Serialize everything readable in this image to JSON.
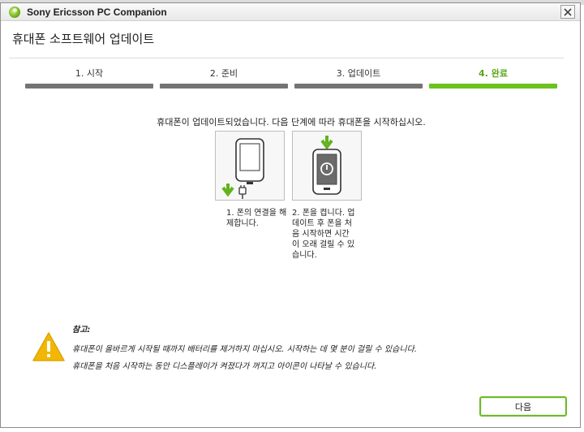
{
  "window": {
    "title": "Sony Ericsson PC Companion"
  },
  "header": {
    "title": "휴대폰 소프트웨어 업데이트"
  },
  "steps": [
    {
      "label": "1. 시작"
    },
    {
      "label": "2. 준비"
    },
    {
      "label": "3. 업데이트"
    },
    {
      "label": "4. 완료"
    }
  ],
  "active_step": "4. 완료",
  "instruction": "휴대폰이 업데이트되었습니다. 다음 단계에 따라 휴대폰을 시작하십시오.",
  "step_cards": [
    {
      "icon": "phone-unplug-icon",
      "text_lines": [
        "1. 폰의 연결을 해",
        "제합니다."
      ]
    },
    {
      "icon": "phone-power-icon",
      "text_lines": [
        "2. 폰을 켭니다. 업",
        "데이트 후 폰을 처",
        "음 시작하면 시간",
        "이 오래 걸릴 수 있",
        "습니다."
      ]
    }
  ],
  "note": {
    "title": "참고:",
    "lines": [
      "휴대폰이 올바르게 시작될 때까지 배터리를 제거하지 마십시오. 시작하는 데 몇 분이 걸릴 수 있습니다.",
      "휴대폰을 처음 시작하는 동안 디스플레이가 켜졌다가 꺼지고 아이콘이 나타날 수 있습니다."
    ]
  },
  "buttons": {
    "next": "다음"
  },
  "colors": {
    "accent": "#6cc21e",
    "inactive_bar": "#747474",
    "warning": "#f2b705"
  },
  "icons": {
    "app": "sony-ericsson-logo-icon",
    "close": "close-icon",
    "warning": "warning-icon"
  }
}
